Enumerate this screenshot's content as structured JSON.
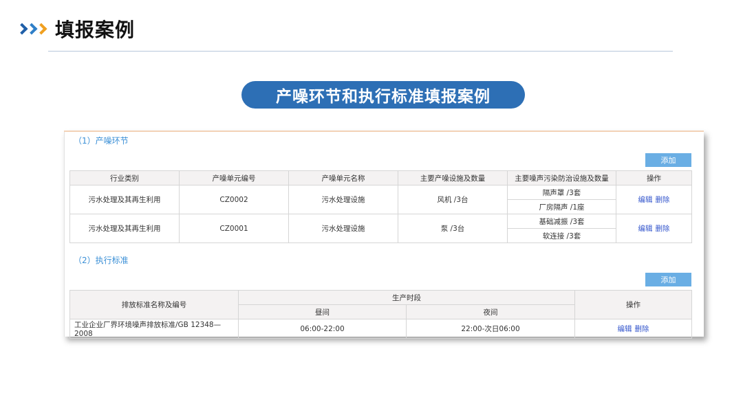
{
  "header": {
    "title": "填报案例"
  },
  "banner": {
    "title": "产噪环节和执行标准填报案例"
  },
  "section1": {
    "title": "（1）产噪环节",
    "add_label": "添加",
    "columns": [
      "行业类别",
      "产噪单元编号",
      "产噪单元名称",
      "主要产噪设施及数量",
      "主要噪声污染防治设施及数量",
      "操作"
    ],
    "rows": [
      {
        "industry": "污水处理及其再生利用",
        "unit_code": "CZ0002",
        "unit_name": "污水处理设施",
        "facility": "风机 /3台",
        "controls": [
          "隔声罩 /3套",
          "厂房隔声 /1座"
        ],
        "edit": "编辑",
        "delete": "删除"
      },
      {
        "industry": "污水处理及其再生利用",
        "unit_code": "CZ0001",
        "unit_name": "污水处理设施",
        "facility": "泵 /3台",
        "controls": [
          "基础减振 /3套",
          "软连接 /3套"
        ],
        "edit": "编辑",
        "delete": "删除"
      }
    ]
  },
  "section2": {
    "title": "（2）执行标准",
    "add_label": "添加",
    "col_name": "排放标准名称及编号",
    "col_period": "生产时段",
    "col_day": "昼间",
    "col_night": "夜间",
    "col_ops": "操作",
    "rows": [
      {
        "name": "工业企业厂界环境噪声排放标准/GB 12348—2008",
        "day": "06:00-22:00",
        "night": "22:00-次日06:00",
        "edit": "编辑",
        "delete": "删除"
      }
    ]
  },
  "colors": {
    "accent": "#2d6fb5",
    "link": "#3355cc",
    "section": "#3a8fd6",
    "button": "#6aaee4"
  }
}
